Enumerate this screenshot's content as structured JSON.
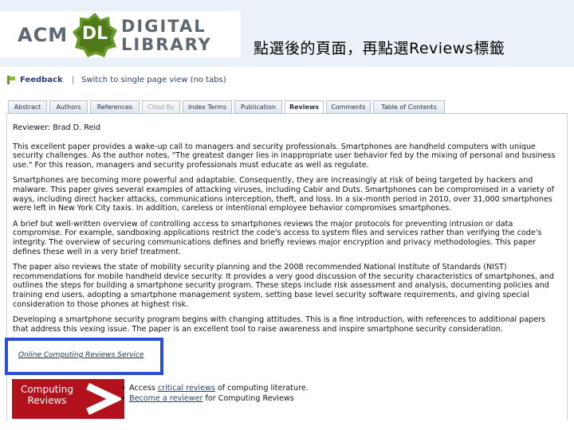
{
  "header": {
    "logo": {
      "acm": "ACM",
      "badge": "DL",
      "word1": "DIGITAL",
      "word2": "LIBRARY"
    },
    "caption": "點選後的頁面，再點選Reviews標籤"
  },
  "feedback_bar": {
    "feedback_label": "Feedback",
    "separator": "|",
    "switch_label": "Switch to single page view (no tabs)"
  },
  "tabs": [
    {
      "label": "Abstract",
      "state": "normal"
    },
    {
      "label": "Authors",
      "state": "normal"
    },
    {
      "label": "References",
      "state": "normal"
    },
    {
      "label": "Cited By",
      "state": "disabled"
    },
    {
      "label": "Index Terms",
      "state": "normal"
    },
    {
      "label": "Publication",
      "state": "normal"
    },
    {
      "label": "Reviews",
      "state": "active"
    },
    {
      "label": "Comments",
      "state": "normal"
    },
    {
      "label": "Table of Contents",
      "state": "normal"
    }
  ],
  "review": {
    "reviewer": "Reviewer: Brad D. Reid",
    "paragraphs": [
      "This excellent paper provides a wake-up call to managers and security professionals. Smartphones are handheld computers with unique security challenges. As the author notes, \"The greatest danger lies in inappropriate user behavior fed by the mixing of personal and business use.\" For this reason, managers and security professionals must educate as well as regulate.",
      "Smartphones are becoming more powerful and adaptable. Consequently, they are increasingly at risk of being targeted by hackers and malware. This paper gives several examples of attacking viruses, including Cabir and Duts. Smartphones can be compromised in a variety of ways, including direct hacker attacks, communications interception, theft, and loss. In a six-month period in 2010, over 31,000 smartphones were left in New York City taxis. In addition, careless or intentional employee behavior compromises smartphones.",
      "A brief but well-written overview of controlling access to smartphones reviews the major protocols for preventing intrusion or data compromise. For example, sandboxing applications restrict the code's access to system files and services rather than verifying the code's integrity. The overview of securing communications defines and briefly reviews major encryption and privacy methodologies. This paper defines these well in a very brief treatment.",
      "The paper also reviews the state of mobility security planning and the 2008 recommended National Institute of Standards (NIST) recommendations for mobile handheld device security. It provides a very good discussion of the security characteristics of smartphones, and outlines the steps for building a smartphone security program. These steps include risk assessment and analysis, documenting policies and training end users, adopting a smartphone management system, setting base level security software requirements, and giving special consideration to those phones at highest risk.",
      "Developing a smartphone security program begins with changing attitudes. This is a fine introduction, with references to additional papers that address this vexing issue. The paper is an excellent tool to raise awareness and inspire smartphone security consideration."
    ]
  },
  "cr_link": "Online Computing Reviews Service",
  "cr_logo": {
    "line1": "Computing",
    "line2": "Reviews"
  },
  "cr_list": {
    "row1_prefix": "Access ",
    "row1_link": "critical reviews",
    "row1_suffix": " of computing literature.",
    "row2_link": "Become a reviewer",
    "row2_suffix": " for Computing Reviews"
  },
  "colors": {
    "header_band": "#eaf1f8",
    "logo_green": "#6a9a2a",
    "highlight_border": "#2a4fd6",
    "cr_red": "#b3111c",
    "link_blue": "#2a3f6e"
  }
}
